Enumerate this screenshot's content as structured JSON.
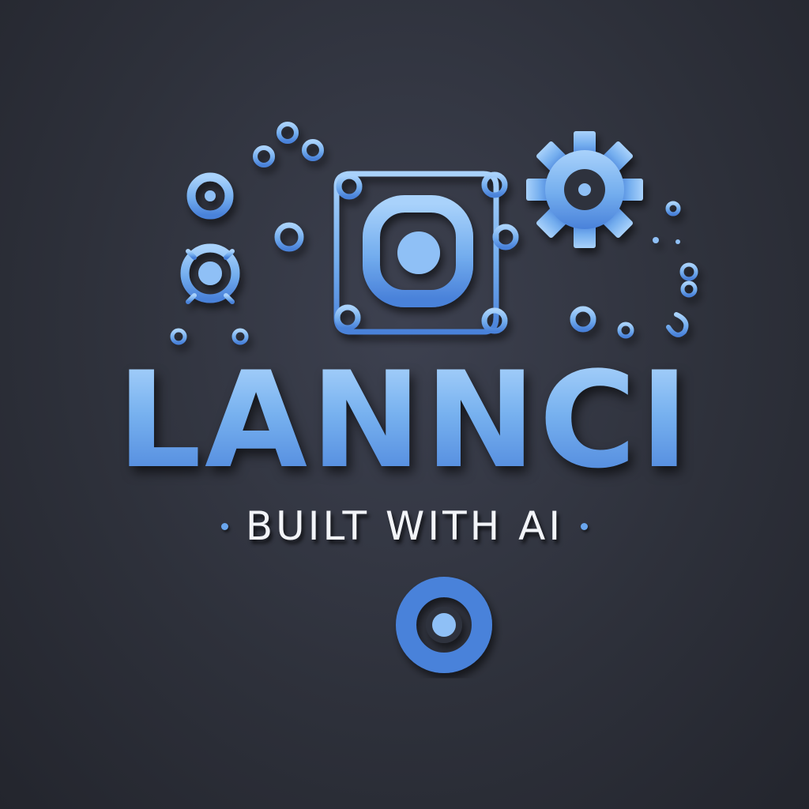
{
  "logo": {
    "name": "LANNCI",
    "tagline": "BUILT WITH AI",
    "colors": {
      "background": "#2e313b",
      "accent_light": "#a9d2fb",
      "accent": "#6fa9ef",
      "accent_dark": "#3f74d1",
      "tagline_text": "#f2f4f8"
    },
    "icons": [
      "circuit-traces-icon",
      "gear-icon",
      "chip-icon",
      "target-circle-icon"
    ]
  }
}
